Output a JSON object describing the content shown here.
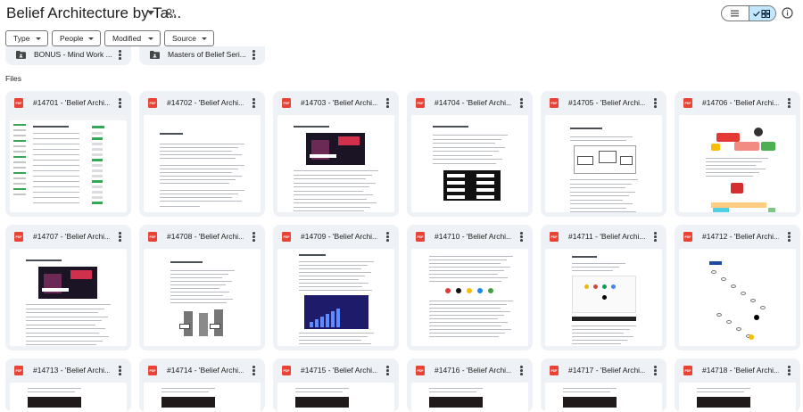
{
  "header": {
    "title": "Belief Architecture by Ta...",
    "share_icon": "shared-people-icon",
    "list_view_icon": "list-view-icon",
    "grid_view_icon": "grid-view-icon",
    "info_icon": "info-icon"
  },
  "filters": [
    {
      "label": "Type"
    },
    {
      "label": "People"
    },
    {
      "label": "Modified"
    },
    {
      "label": "Source"
    }
  ],
  "folders": [
    {
      "label": "BONUS - Mind Work ..."
    },
    {
      "label": "Masters of Belief Seri..."
    }
  ],
  "files_heading": "Files",
  "files": [
    {
      "name": "#14701 - 'Belief Archi...",
      "thumb": "dashboard"
    },
    {
      "name": "#14702 - 'Belief Archi...",
      "thumb": "text"
    },
    {
      "name": "#14703 - 'Belief Archi...",
      "thumb": "video"
    },
    {
      "name": "#14704 - 'Belief Archi...",
      "thumb": "boxes"
    },
    {
      "name": "#14705 - 'Belief Archi...",
      "thumb": "diagram"
    },
    {
      "name": "#14706 - 'Belief Archi...",
      "thumb": "colorful"
    },
    {
      "name": "#14707 - 'Belief Archi...",
      "thumb": "video"
    },
    {
      "name": "#14708 - 'Belief Archi...",
      "thumb": "bars"
    },
    {
      "name": "#14709 - 'Belief Archi...",
      "thumb": "chart"
    },
    {
      "name": "#14710 - 'Belief Archi...",
      "thumb": "icons"
    },
    {
      "name": "#14711 - 'Belief Archi...",
      "thumb": "dots"
    },
    {
      "name": "#14712 - 'Belief Archi...",
      "thumb": "flow"
    },
    {
      "name": "#14713 - 'Belief Archi...",
      "thumb": "partial"
    },
    {
      "name": "#14714 - 'Belief Archi...",
      "thumb": "partial"
    },
    {
      "name": "#14715 - 'Belief Archi...",
      "thumb": "partial"
    },
    {
      "name": "#14716 - 'Belief Archi...",
      "thumb": "partial"
    },
    {
      "name": "#14717 - 'Belief Archi...",
      "thumb": "partial"
    },
    {
      "name": "#14718 - 'Belief Archi...",
      "thumb": "partial"
    }
  ],
  "file_type_badge": "PDF",
  "colors": {
    "accent_selected": "#c2e7ff",
    "pdf_red": "#ea4335",
    "card_bg": "#eef1f5"
  }
}
